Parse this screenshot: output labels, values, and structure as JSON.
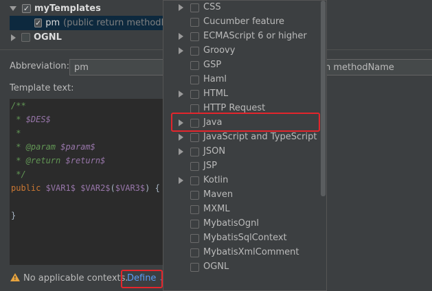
{
  "tree": {
    "group_label": "myTemplates",
    "template_abbrev": "pm",
    "template_desc": "(public return methodNa",
    "group2_label": "OGNL"
  },
  "abbreviation": {
    "label": "Abbreviation:",
    "value": "pm",
    "description_value": "n methodName"
  },
  "template_text": {
    "label": "Template text:",
    "lines": [
      "/**",
      " * $DES$",
      " *",
      " * @param $param$",
      " * @return $return$",
      " */",
      "public $VAR1$ $VAR2$($VAR3$) {",
      "",
      "}"
    ]
  },
  "footer": {
    "warning_icon": "warning-icon",
    "warning_text": "No applicable contexts.",
    "define_label": "Define"
  },
  "popup": {
    "items": [
      {
        "label": "CSS",
        "expandable": true
      },
      {
        "label": "Cucumber feature",
        "expandable": false
      },
      {
        "label": "ECMAScript 6 or higher",
        "expandable": true
      },
      {
        "label": "Groovy",
        "expandable": true
      },
      {
        "label": "GSP",
        "expandable": false
      },
      {
        "label": "Haml",
        "expandable": false
      },
      {
        "label": "HTML",
        "expandable": true
      },
      {
        "label": "HTTP Request",
        "expandable": false
      },
      {
        "label": "Java",
        "expandable": true
      },
      {
        "label": "JavaScript and TypeScript",
        "expandable": true
      },
      {
        "label": "JSON",
        "expandable": true
      },
      {
        "label": "JSP",
        "expandable": false
      },
      {
        "label": "Kotlin",
        "expandable": true
      },
      {
        "label": "Maven",
        "expandable": false
      },
      {
        "label": "MXML",
        "expandable": false
      },
      {
        "label": "MybatisOgnl",
        "expandable": false
      },
      {
        "label": "MybatisSqlContext",
        "expandable": false
      },
      {
        "label": "MybatisXmlComment",
        "expandable": false
      },
      {
        "label": "OGNL",
        "expandable": false
      }
    ]
  },
  "colors": {
    "highlight_red": "#e5252c",
    "define_blue": "#589df6",
    "selection": "#0d293e"
  }
}
